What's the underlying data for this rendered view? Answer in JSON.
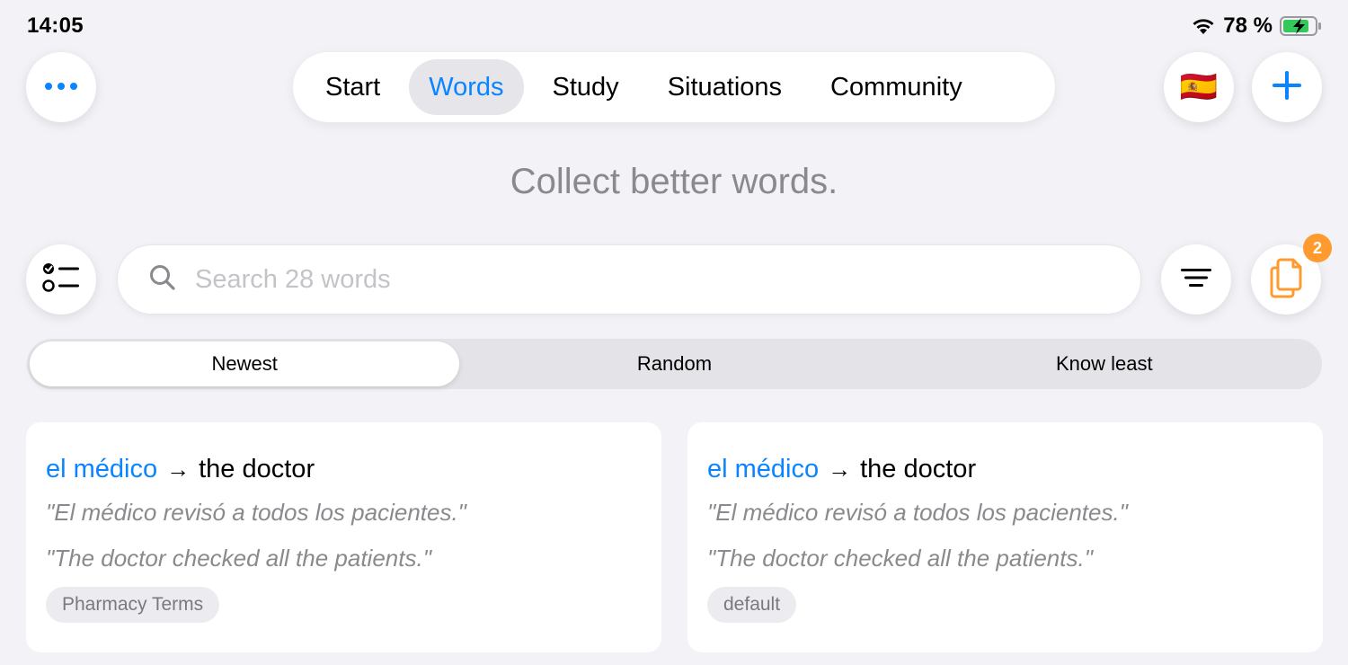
{
  "status": {
    "time": "14:05",
    "battery": "78 %"
  },
  "colors": {
    "accent": "#0a84ff",
    "badge": "#ff9b2e",
    "clipboard": "#ff9b2e"
  },
  "header": {
    "more_icon": "ellipsis-icon",
    "tabs": [
      {
        "label": "Start",
        "active": false
      },
      {
        "label": "Words",
        "active": true
      },
      {
        "label": "Study",
        "active": false
      },
      {
        "label": "Situations",
        "active": false
      },
      {
        "label": "Community",
        "active": false
      }
    ],
    "flag": "🇪🇸",
    "add_icon": "plus-icon"
  },
  "headline": "Collect better words.",
  "search": {
    "placeholder": "Search 28 words",
    "value": ""
  },
  "clipboard_badge": "2",
  "sort_tabs": [
    {
      "label": "Newest",
      "active": true
    },
    {
      "label": "Random",
      "active": false
    },
    {
      "label": "Know least",
      "active": false
    }
  ],
  "cards": [
    {
      "word": "el médico",
      "arrow": "→",
      "translation": "the doctor",
      "example_es": "\"El médico revisó a todos los pacientes.\"",
      "example_en": "\"The doctor checked all the patients.\"",
      "tag": "Pharmacy Terms"
    },
    {
      "word": "el médico",
      "arrow": "→",
      "translation": "the doctor",
      "example_es": "\"El médico revisó a todos los pacientes.\"",
      "example_en": "\"The doctor checked all the patients.\"",
      "tag": "default"
    }
  ]
}
